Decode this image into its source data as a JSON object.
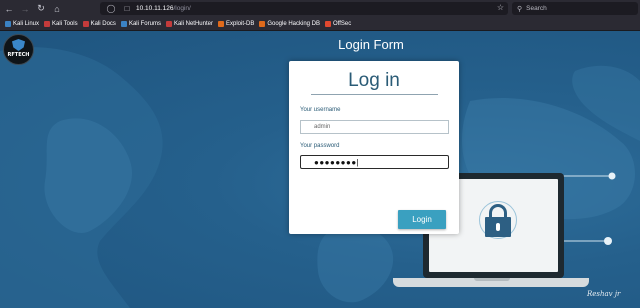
{
  "browser": {
    "url_host": "10.10.11.126",
    "url_path": "/login/",
    "search_placeholder": "Search",
    "bookmarks": [
      {
        "label": "Kali Linux",
        "color": "#3b82c4"
      },
      {
        "label": "Kali Tools",
        "color": "#c43b3b"
      },
      {
        "label": "Kali Docs",
        "color": "#c43b3b"
      },
      {
        "label": "Kali Forums",
        "color": "#3b82c4"
      },
      {
        "label": "Kali NetHunter",
        "color": "#c43b3b"
      },
      {
        "label": "Exploit-DB",
        "color": "#e06a1b"
      },
      {
        "label": "Google Hacking DB",
        "color": "#e06a1b"
      },
      {
        "label": "OffSec",
        "color": "#e0482f"
      }
    ]
  },
  "page": {
    "title": "Login Form",
    "logo_text": "RFTECH",
    "signature": "Reshav jr"
  },
  "login": {
    "heading": "Log in",
    "username_label": "Your username",
    "username_value": "admin",
    "password_label": "Your password",
    "password_value": "●●●●●●●●|",
    "submit_label": "Login"
  },
  "colors": {
    "accent": "#3aa0c0",
    "heading": "#2a5b76",
    "background": "#25608c"
  }
}
